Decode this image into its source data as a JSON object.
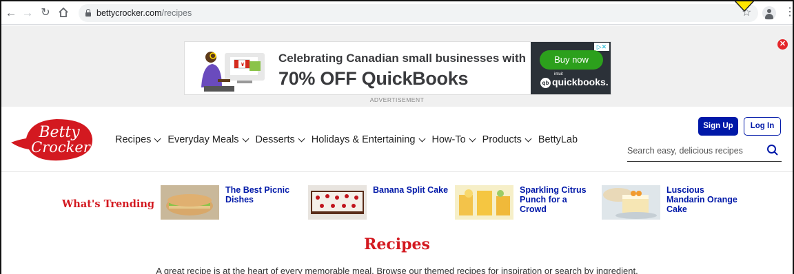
{
  "browser": {
    "url_host": "bettycrocker.com",
    "url_path": "/recipes",
    "icons": [
      "back-icon",
      "forward-icon",
      "reload-icon",
      "home-icon",
      "lock-icon",
      "bookmark-star-icon",
      "profile-icon",
      "menu-kebab-icon"
    ]
  },
  "ad": {
    "line1": "Celebrating Canadian small businesses with",
    "line2": "70% OFF QuickBooks",
    "cta": "Buy now",
    "brand": "quickbooks.",
    "brand_prefix": "intuit",
    "label": "ADVERTISEMENT",
    "accent": "#2ca01c"
  },
  "site": {
    "logo_line1": "Betty",
    "logo_line2": "Crocker",
    "nav": [
      {
        "label": "Recipes",
        "dropdown": true
      },
      {
        "label": "Everyday Meals",
        "dropdown": true
      },
      {
        "label": "Desserts",
        "dropdown": true
      },
      {
        "label": "Holidays & Entertaining",
        "dropdown": true
      },
      {
        "label": "How-To",
        "dropdown": true
      },
      {
        "label": "Products",
        "dropdown": true
      },
      {
        "label": "BettyLab",
        "dropdown": false
      }
    ],
    "signup": "Sign Up",
    "login": "Log In",
    "search_placeholder": "Search easy, delicious recipes",
    "brand_red": "#d31920",
    "brand_blue": "#0018a8"
  },
  "trending": {
    "title": "What's Trending",
    "items": [
      {
        "title": "The Best Picnic Dishes"
      },
      {
        "title": "Banana Split Cake"
      },
      {
        "title": "Sparkling Citrus Punch for a Crowd"
      },
      {
        "title": "Luscious Mandarin Orange Cake"
      }
    ]
  },
  "page": {
    "title": "Recipes",
    "description": "A great recipe is at the heart of every memorable meal. Browse our themed recipes for inspiration or search by ingredient."
  }
}
